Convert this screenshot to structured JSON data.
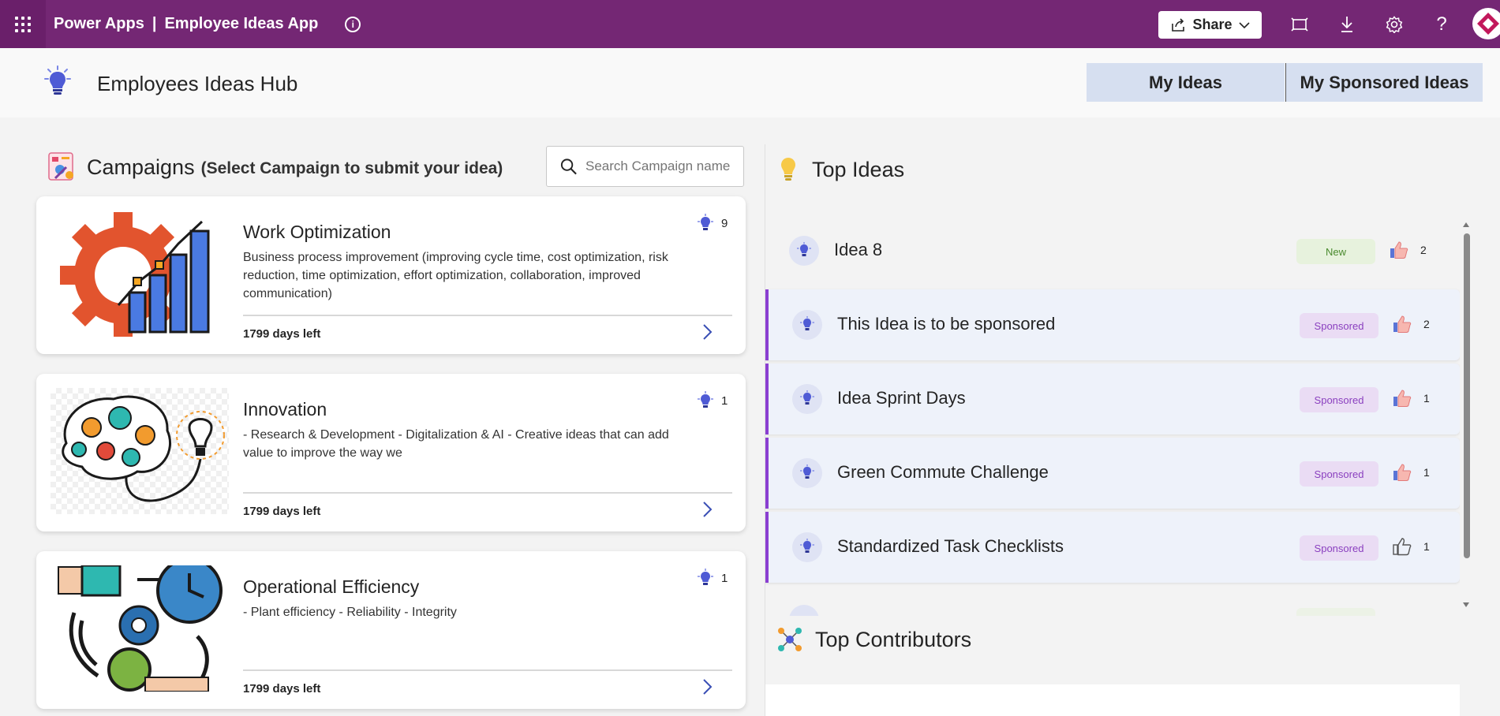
{
  "topbar": {
    "app_name": "Power Apps",
    "separator": "|",
    "app_title": "Employee Ideas App",
    "share_label": "Share",
    "icons": [
      "waffle-icon",
      "info-icon",
      "share-icon",
      "fit-screen-icon",
      "download-icon",
      "settings-icon",
      "help-icon"
    ]
  },
  "header": {
    "title": "Employees Ideas Hub",
    "my_ideas_label": "My Ideas",
    "my_sponsored_label": "My Sponsored Ideas"
  },
  "campaigns": {
    "title": "Campaigns",
    "subtitle": "(Select Campaign to submit your idea)",
    "search_placeholder": "Search Campaign name",
    "items": [
      {
        "title": "Work Optimization",
        "description": "Business process improvement (improving cycle time, cost optimization, risk reduction, time optimization, effort optimization, collaboration, improved communication)",
        "count": "9",
        "days_left": "1799 days left"
      },
      {
        "title": "Innovation",
        "description": "- Research & Development - Digitalization & AI - Creative ideas that can add value to improve the way we",
        "count": "1",
        "days_left": "1799 days left"
      },
      {
        "title": "Operational Efficiency",
        "description": "- Plant efficiency - Reliability - Integrity",
        "count": "1",
        "days_left": "1799 days left"
      }
    ]
  },
  "top_ideas": {
    "title": "Top Ideas",
    "items": [
      {
        "name": "Idea 8",
        "badge": "New",
        "likes": "2"
      },
      {
        "name": "This Idea is to be sponsored",
        "badge": "Sponsored",
        "likes": "2"
      },
      {
        "name": "Idea Sprint Days",
        "badge": "Sponsored",
        "likes": "1"
      },
      {
        "name": "Green Commute Challenge",
        "badge": "Sponsored",
        "likes": "1"
      },
      {
        "name": "Standardized Task Checklists",
        "badge": "Sponsored",
        "likes": "1"
      }
    ]
  },
  "top_contributors": {
    "title": "Top Contributors"
  },
  "colors": {
    "topbar": "#742774",
    "header_button": "#d6dff0",
    "sponsored_accent": "#8a3fd1",
    "bulb": "#4f5bd5"
  }
}
